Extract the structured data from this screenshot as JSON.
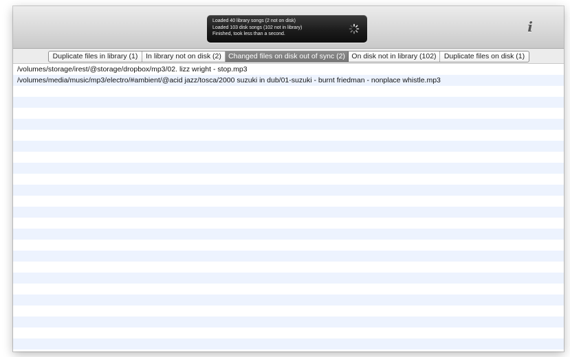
{
  "hud": {
    "lines": [
      "Loaded 40 library songs (2 not on disk)",
      "Loaded 103 disk songs (102 not in library)",
      "Finished, took less than a second."
    ],
    "spinner_icon": "activity-spinner-icon"
  },
  "toolbar": {
    "info_label": "i",
    "info_icon": "info-icon"
  },
  "tabs": [
    {
      "label": "Duplicate files in library (1)",
      "selected": false
    },
    {
      "label": "In library not on disk (2)",
      "selected": false
    },
    {
      "label": "Changed files on disk out of sync (2)",
      "selected": true
    },
    {
      "label": "On disk not in library (102)",
      "selected": false
    },
    {
      "label": "Duplicate files on disk (1)",
      "selected": false
    }
  ],
  "files": [
    "/volumes/storage/irest/@storage/dropbox/mp3/02. lizz wright - stop.mp3",
    "/volumes/media/music/mp3/electro/#ambient/@acid jazz/tosca/2000 suzuki in dub/01-suzuki - burnt friedman - nonplace whistle.mp3"
  ],
  "colors": {
    "selected_tab": "#7f7f7f",
    "row_stripe": "#edf3fe",
    "hud_background": "#1c1c1c"
  }
}
